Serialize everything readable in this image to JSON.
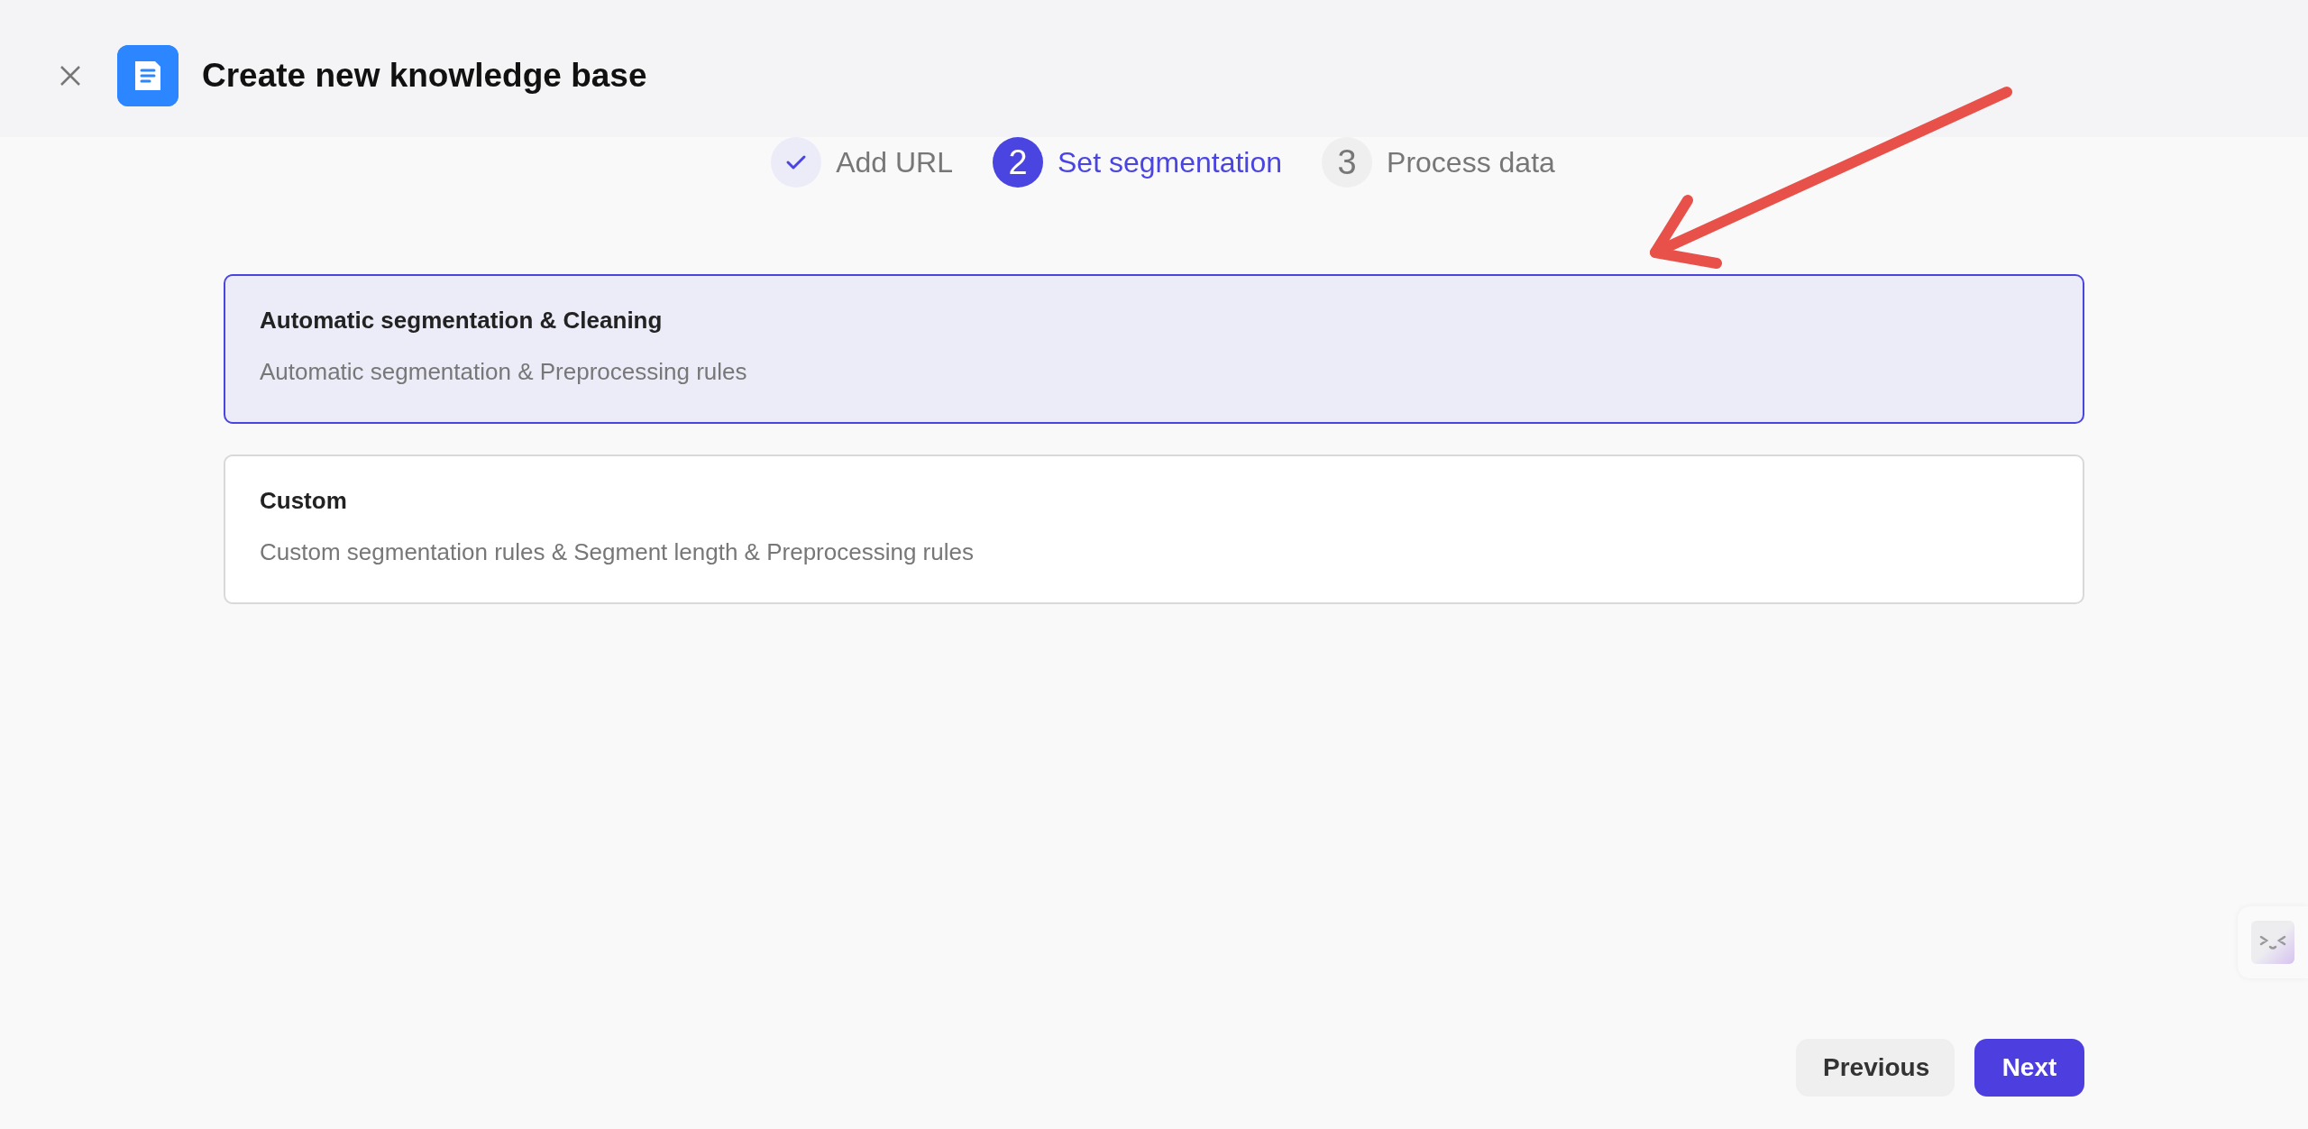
{
  "header": {
    "title": "Create new knowledge base"
  },
  "steps": [
    {
      "label": "Add URL",
      "completed": true,
      "selected": false
    },
    {
      "number": "2",
      "label": "Set segmentation",
      "completed": false,
      "selected": true
    },
    {
      "number": "3",
      "label": "Process data",
      "completed": false,
      "selected": false
    }
  ],
  "options": [
    {
      "title": "Automatic segmentation & Cleaning",
      "description": "Automatic segmentation & Preprocessing rules",
      "selected": true
    },
    {
      "title": "Custom",
      "description": "Custom segmentation rules & Segment length & Preprocessing rules",
      "selected": false
    }
  ],
  "buttons": [
    {
      "label": "Previous",
      "kind": "secondary"
    },
    {
      "label": "Next",
      "kind": "primary"
    }
  ]
}
